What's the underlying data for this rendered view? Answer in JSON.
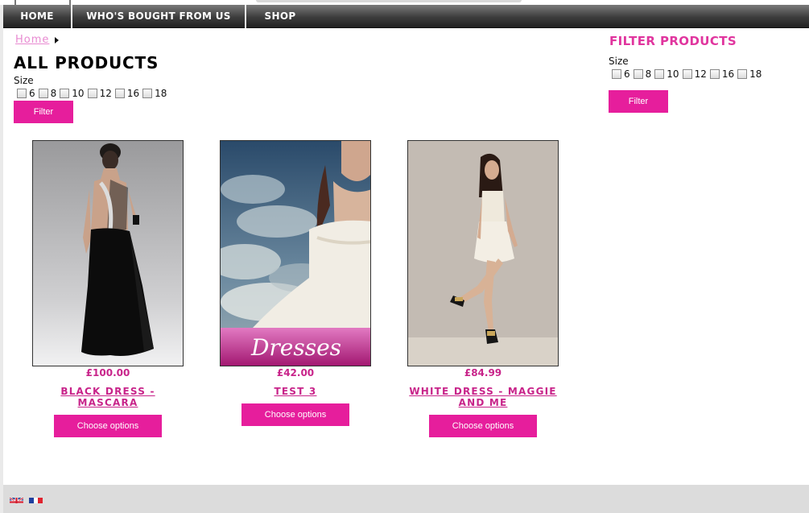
{
  "nav": {
    "items": [
      {
        "label": "HOME"
      },
      {
        "label": "WHO'S BOUGHT FROM US"
      },
      {
        "label": "SHOP"
      }
    ]
  },
  "breadcrumb": {
    "home": "Home"
  },
  "page": {
    "title": "ALL PRODUCTS"
  },
  "size_filter": {
    "label": "Size",
    "options": [
      "6",
      "8",
      "10",
      "12",
      "16",
      "18"
    ],
    "button": "Filter"
  },
  "sidebar": {
    "heading": "FILTER PRODUCTS",
    "label": "Size",
    "options": [
      "6",
      "8",
      "10",
      "12",
      "16",
      "18"
    ],
    "button": "Filter"
  },
  "products": [
    {
      "price": "£100.00",
      "name": "BLACK DRESS - MASCARA",
      "button": "Choose options"
    },
    {
      "price": "£42.00",
      "name": "TEST 3",
      "button": "Choose options",
      "banner": "Dresses"
    },
    {
      "price": "£84.99",
      "name": "WHITE DRESS - MAGGIE AND ME",
      "button": "Choose options"
    }
  ],
  "colors": {
    "accent": "#e61e9c",
    "link": "#c8248a",
    "heading": "#e0359e"
  },
  "footer": {
    "flags": [
      "uk-flag-icon",
      "france-flag-icon"
    ]
  }
}
